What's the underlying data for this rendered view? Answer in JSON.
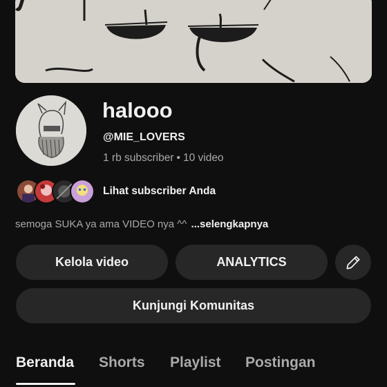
{
  "channel": {
    "name": "halooo",
    "handle": "@MIE_LOVERS",
    "subscribers": "1 rb subscriber",
    "videos": "10 video",
    "separator": "•"
  },
  "subscribers_link": {
    "label": "Lihat subscriber Anda",
    "avatar_colors": [
      "#8a4a3a",
      "#c53a3a",
      "#2a2a2a",
      "#c9a0d8"
    ]
  },
  "description": {
    "text": "semoga SUKA ya ama VIDEO nya ^^",
    "more_label": "...selengkapnya"
  },
  "actions": {
    "manage_videos": "Kelola video",
    "analytics": "ANALYTICS",
    "edit_icon": "pencil-icon",
    "community": "Kunjungi Komunitas"
  },
  "tabs": [
    {
      "label": "Beranda",
      "active": true
    },
    {
      "label": "Shorts",
      "active": false
    },
    {
      "label": "Playlist",
      "active": false
    },
    {
      "label": "Postingan",
      "active": false
    }
  ],
  "colors": {
    "background": "#0f0f0f",
    "button": "#272727",
    "text": "#f1f1f1",
    "secondary_text": "#aaaaaa"
  }
}
